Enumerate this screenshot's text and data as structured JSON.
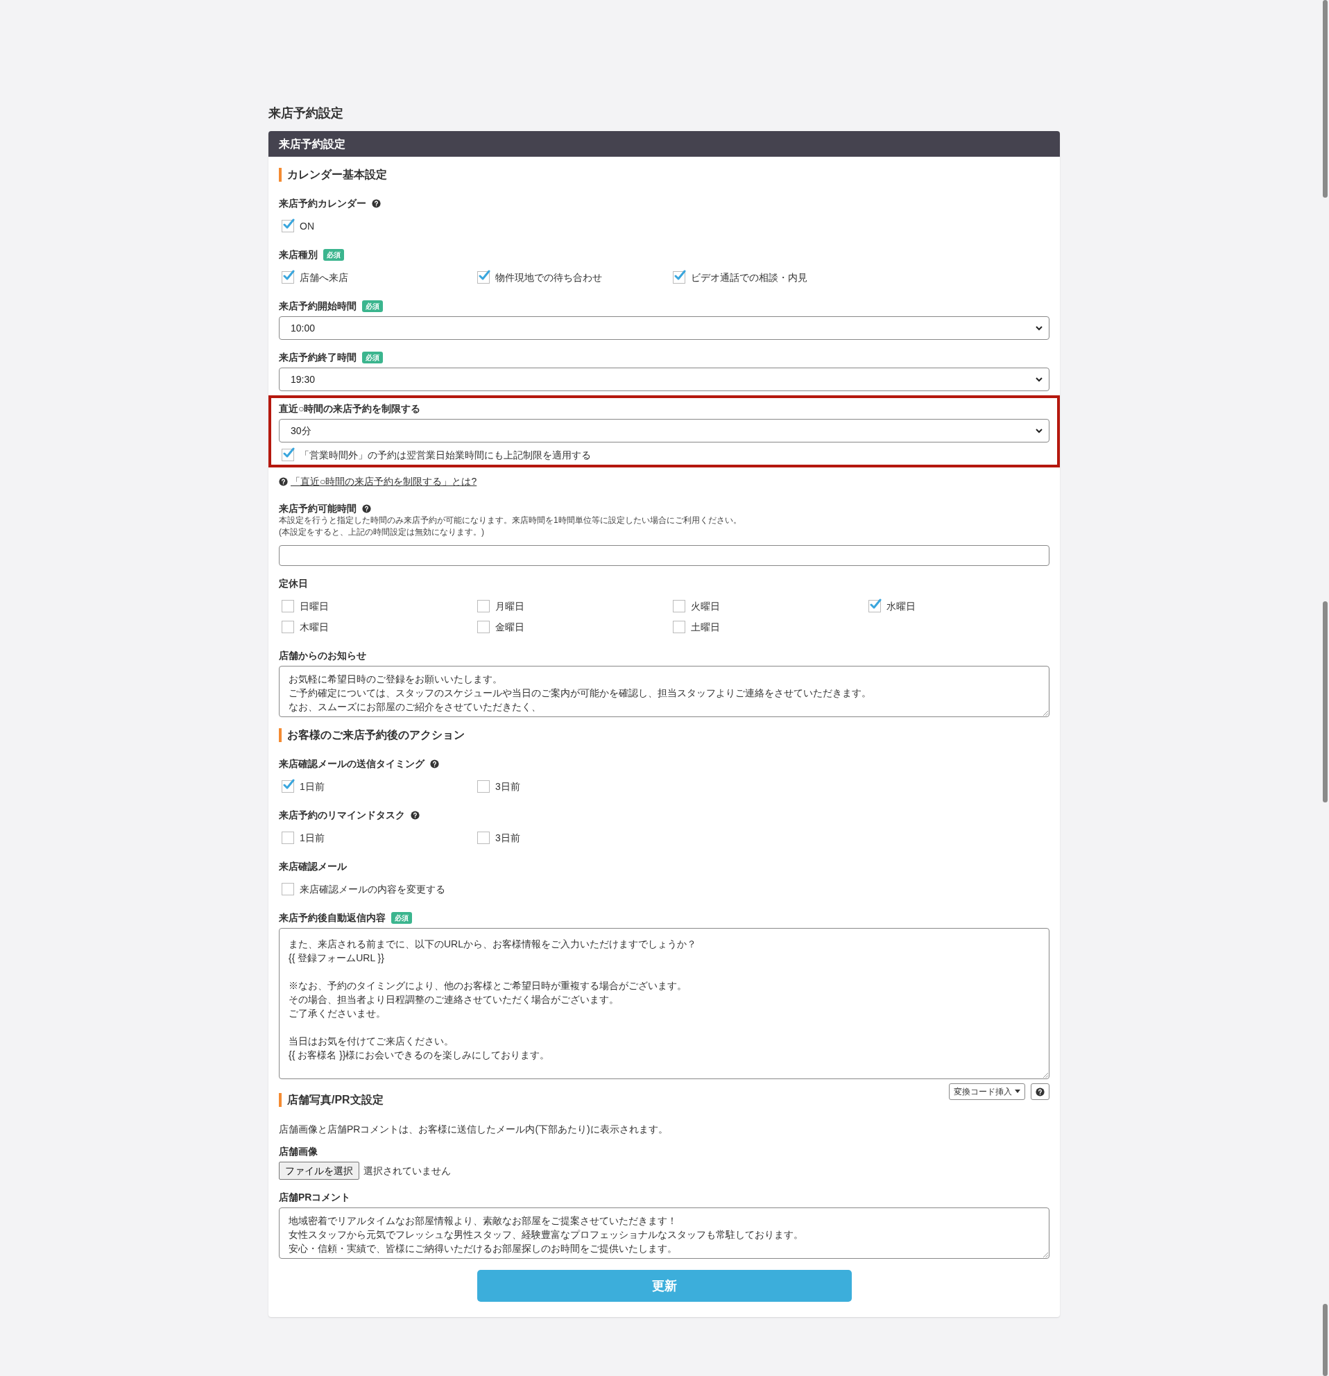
{
  "page_title": "来店予約設定",
  "panel": {
    "title": "来店予約設定",
    "sections": [
      {
        "heading": "カレンダー基本設定",
        "fields": [
          {
            "kind": "checkboxes",
            "label": "来店予約カレンダー",
            "help": true,
            "options": [
              {
                "label": "ON",
                "checked": true
              }
            ]
          },
          {
            "kind": "checkboxes",
            "label": "来店種別",
            "badge": "必須",
            "options": [
              {
                "label": "店舗へ来店",
                "checked": true
              },
              {
                "label": "物件現地での待ち合わせ",
                "checked": true
              },
              {
                "label": "ビデオ通話での相談・内見",
                "checked": true
              }
            ]
          },
          {
            "kind": "select",
            "label": "来店予約開始時間",
            "badge": "必須",
            "value": "10:00"
          },
          {
            "kind": "select",
            "label": "来店予約終了時間",
            "badge": "必須",
            "value": "19:30"
          },
          {
            "kind": "select",
            "label": "直近○時間の来店予約を制限する",
            "highlighted": true,
            "value": "30分",
            "options": [
              {
                "label": "「営業時間外」の予約は翌営業日始業時間にも上記制限を適用する",
                "checked": true
              }
            ]
          },
          {
            "kind": "link",
            "text": "「直近○時間の来店予約を制限する」とは?"
          },
          {
            "kind": "text_input",
            "label": "来店予約可能時間",
            "help": true,
            "description": [
              "本設定を行うと指定した時間のみ来店予約が可能になります。来店時間を1時間単位等に設定したい場合にご利用ください。",
              "(本設定をすると、上記の時間設定は無効になります。)"
            ]
          },
          {
            "kind": "checkboxes",
            "label": "定休日",
            "options": [
              {
                "label": "日曜日",
                "checked": false
              },
              {
                "label": "月曜日",
                "checked": false
              },
              {
                "label": "火曜日",
                "checked": false
              },
              {
                "label": "水曜日",
                "checked": true
              },
              {
                "label": "木曜日",
                "checked": false
              },
              {
                "label": "金曜日",
                "checked": false
              },
              {
                "label": "土曜日",
                "checked": false
              }
            ]
          },
          {
            "kind": "textarea",
            "label": "店舗からのお知らせ",
            "paragraphs": [
              [
                "お気軽に希望日時のご登録をお願いいたします。",
                "ご予約確定については、スタッフのスケジュールや当日のご案内が可能かを確認し、担当スタッフよりご連絡をさせていただきます。",
                "なお、スムーズにお部屋のご紹介をさせていただきたく、"
              ]
            ]
          }
        ]
      },
      {
        "heading": "お客様のご来店予約後のアクション",
        "fields": [
          {
            "kind": "checkboxes",
            "label": "来店確認メールの送信タイミング",
            "help": true,
            "options": [
              {
                "label": "1日前",
                "checked": true
              },
              {
                "label": "3日前",
                "checked": false
              }
            ]
          },
          {
            "kind": "checkboxes",
            "label": "来店予約のリマインドタスク",
            "help": true,
            "options": [
              {
                "label": "1日前",
                "checked": false
              },
              {
                "label": "3日前",
                "checked": false
              }
            ]
          },
          {
            "kind": "checkboxes",
            "label": "来店確認メール",
            "options": [
              {
                "label": "来店確認メールの内容を変更する",
                "checked": false
              }
            ]
          },
          {
            "kind": "textarea",
            "label": "来店予約後自動返信内容",
            "badge": "必須",
            "paragraphs": [
              [
                "また、来店される前までに、以下のURLから、お客様情報をご入力いただけますでしょうか？",
                "{{ 登録フォームURL }}"
              ],
              [
                "※なお、予約のタイミングにより、他のお客様とご希望日時が重複する場合がございます。",
                "その場合、担当者より日程調整のご連絡させていただく場合がございます。",
                "ご了承くださいませ。"
              ],
              [
                "当日はお気を付けてご来店ください。",
                "{{ お客様名 }}様にお会いできるのを楽しみにしております。"
              ]
            ],
            "insert_button": "変換コード挿入"
          }
        ]
      },
      {
        "heading": "店舗写真/PR文設定",
        "fields": [
          {
            "kind": "note",
            "text": "店舗画像と店舗PRコメントは、お客様に送信したメール内(下部あたり)に表示されます。"
          },
          {
            "kind": "file",
            "label": "店舗画像",
            "button": "ファイルを選択",
            "status": "選択されていません"
          },
          {
            "kind": "textarea",
            "label": "店舗PRコメント",
            "paragraphs": [
              [
                "地域密着でリアルタイムなお部屋情報より、素敵なお部屋をご提案させていただきます！",
                "女性スタッフから元気でフレッシュな男性スタッフ、経験豊富なプロフェッショナルなスタッフも常駐しております。",
                "安心・信頼・実績で、皆様にご納得いただけるお部屋探しのお時間をご提供いたします。"
              ]
            ]
          }
        ]
      }
    ],
    "submit": "更新"
  }
}
